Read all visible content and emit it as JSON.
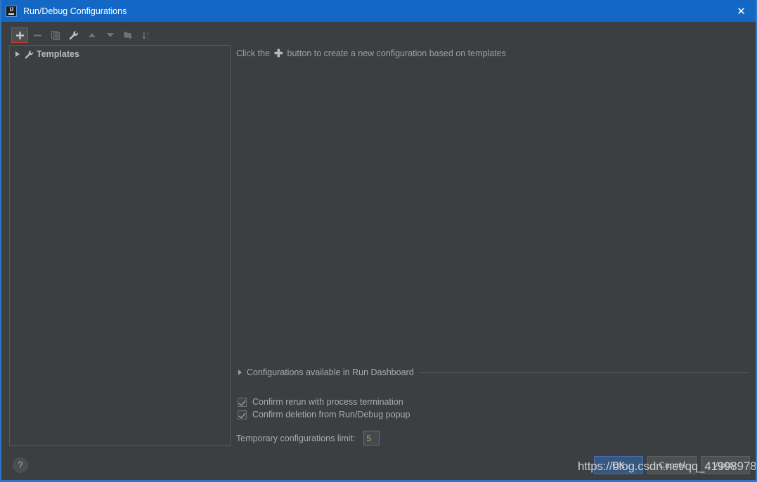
{
  "window": {
    "title": "Run/Debug Configurations",
    "app_icon": "intellij-idea-icon",
    "close_label": "✕",
    "title_bar_color": "#1268c4",
    "background_color": "#3c3f41"
  },
  "toolbar": {
    "buttons": [
      {
        "name": "add-configuration-button",
        "icon": "plus-icon",
        "label": "+",
        "state": "selected"
      },
      {
        "name": "remove-configuration-button",
        "icon": "minus-icon",
        "label": "−",
        "state": "disabled"
      },
      {
        "name": "copy-configuration-button",
        "icon": "copy-icon",
        "label": "",
        "state": "disabled"
      },
      {
        "name": "edit-templates-button",
        "icon": "wrench-icon",
        "label": "",
        "state": "enabled"
      },
      {
        "name": "move-up-button",
        "icon": "arrow-up-icon",
        "label": "▲",
        "state": "disabled"
      },
      {
        "name": "move-down-button",
        "icon": "arrow-down-icon",
        "label": "▼",
        "state": "disabled"
      },
      {
        "name": "new-folder-button",
        "icon": "folder-add-icon",
        "label": "",
        "state": "disabled"
      },
      {
        "name": "sort-alphabetically-button",
        "icon": "sort-az-icon",
        "label": "",
        "state": "disabled"
      }
    ],
    "selection_border_color": "#c0392b"
  },
  "tree": {
    "items": [
      {
        "label": "Templates",
        "icon": "wrench-icon",
        "expanded": false
      }
    ]
  },
  "main": {
    "hint_prefix": "Click the",
    "hint_plus": "✚",
    "hint_suffix": "button to create a new configuration based on templates",
    "dashboard_section_label": "Configurations available in Run Dashboard",
    "checkboxes": [
      {
        "label": "Confirm rerun with process termination",
        "checked": true
      },
      {
        "label": "Confirm deletion from Run/Debug popup",
        "checked": true
      }
    ],
    "temp_limit_label": "Temporary configurations limit:",
    "temp_limit_value": "5"
  },
  "footer": {
    "help_label": "?",
    "buttons": [
      {
        "label": "OK",
        "name": "ok-button",
        "primary": true
      },
      {
        "label": "Cancel",
        "name": "cancel-button",
        "primary": false
      },
      {
        "label": "Apply",
        "name": "apply-button",
        "primary": false
      }
    ]
  },
  "watermark": {
    "text": "https://blog.csdn.net/qq_41998978"
  }
}
